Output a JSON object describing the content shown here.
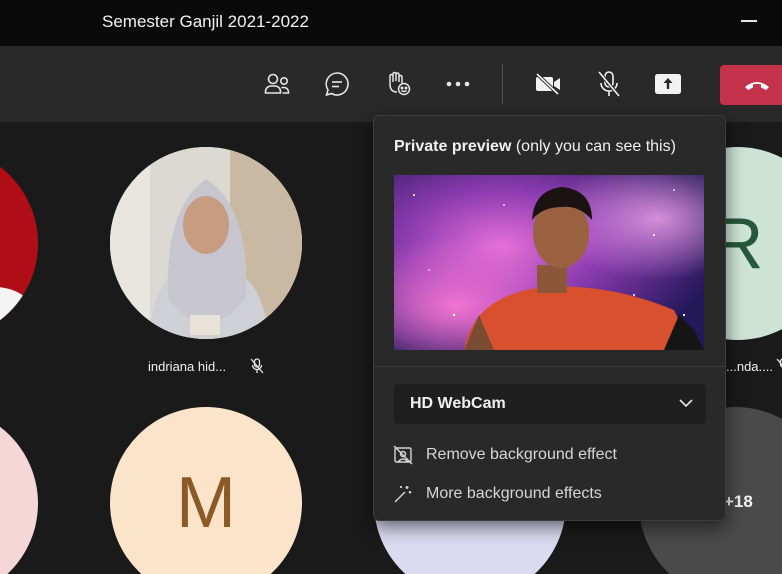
{
  "window": {
    "title": "Semester Ganjil 2021-2022"
  },
  "toolbar": {
    "participants_icon": "people-icon",
    "chat_icon": "chat-icon",
    "reactions_icon": "raise-hand-react-icon",
    "more_icon": "more-icon",
    "camera_icon": "camera-off-icon",
    "mic_icon": "mic-off-icon",
    "share_icon": "share-screen-icon",
    "leave_icon": "hang-up-icon"
  },
  "participants": [
    {
      "name": "indriana hid...",
      "muted": true
    },
    {
      "name": "...nda....",
      "muted": true
    },
    {
      "avatar_letter": "M"
    },
    {
      "avatar_letter": "R"
    },
    {
      "overflow_count": "+18"
    }
  ],
  "preview_popup": {
    "title_bold": "Private preview",
    "title_rest": " (only you can see this)",
    "camera_select": "HD WebCam",
    "items": [
      {
        "label": "Remove background effect",
        "icon": "no-background-icon"
      },
      {
        "label": "More background effects",
        "icon": "magic-wand-icon"
      }
    ]
  },
  "colors": {
    "leave_button": "#c4314b",
    "popup_bg": "#292929",
    "titlebar_bg": "#0a0a0a",
    "toolbar_bg": "#292929"
  }
}
